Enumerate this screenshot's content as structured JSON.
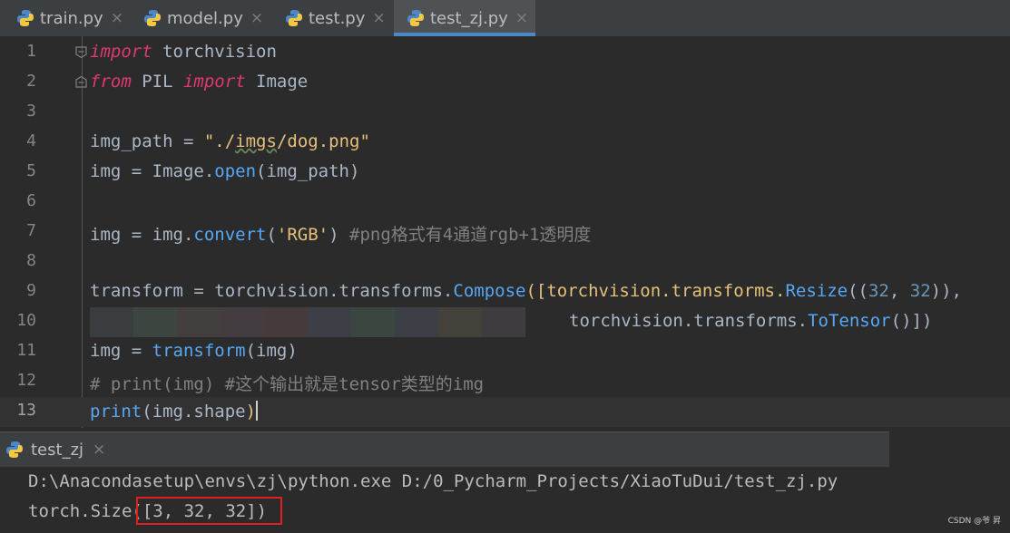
{
  "tabs": [
    {
      "label": "train.py",
      "active": false
    },
    {
      "label": "model.py",
      "active": false
    },
    {
      "label": "test.py",
      "active": false
    },
    {
      "label": "test_zj.py",
      "active": true
    }
  ],
  "close_glyph": "×",
  "editor": {
    "current_line": 13,
    "lines": [
      {
        "n": "1"
      },
      {
        "n": "2"
      },
      {
        "n": "3"
      },
      {
        "n": "4"
      },
      {
        "n": "5"
      },
      {
        "n": "6"
      },
      {
        "n": "7"
      },
      {
        "n": "8"
      },
      {
        "n": "9"
      },
      {
        "n": "10"
      },
      {
        "n": "11"
      },
      {
        "n": "12"
      },
      {
        "n": "13"
      }
    ],
    "tokens": {
      "l1_import": "import",
      "l1_mod": " torchvision",
      "l2_from": "from",
      "l2_pil": " PIL ",
      "l2_import": "import",
      "l2_image": " Image",
      "l4_var": "img_path = ",
      "l4_q1": "\"./",
      "l4_imgs": "imgs",
      "l4_rest": "/dog.png\"",
      "l5_a": "img = Image.",
      "l5_fn": "open",
      "l5_b": "(img_path)",
      "l7_a": "img = img.",
      "l7_fn": "convert",
      "l7_b": "(",
      "l7_str": "'RGB'",
      "l7_c": ") ",
      "l7_cm": "#png格式有4通道rgb+1透明度",
      "l9_a": "transform = torchvision.transforms.",
      "l9_fn": "Compose",
      "l9_b": "([torchvision.transforms.",
      "l9_fn2": "Resize",
      "l9_c": "((",
      "l9_n1": "32",
      "l9_d": ", ",
      "l9_n2": "32",
      "l9_e": ")),",
      "l10_a": "torchvision.transforms.",
      "l10_fn": "ToTensor",
      "l10_b": "()])",
      "l11_a": "img = ",
      "l11_fn": "transform",
      "l11_b": "(img)",
      "l12_cm": "# print(img) #这个输出就是tensor类型的img",
      "l13_fn": "print",
      "l13_a": "(img.shape",
      "l13_b": ")"
    },
    "colors": {
      "keyword": "#e0386e",
      "string": "#e6c07b",
      "function": "#56a8f5",
      "number": "#6897bb",
      "comment": "#808080",
      "text": "#a9b7c6"
    }
  },
  "run": {
    "tab_label": "test_zj",
    "output": [
      "D:\\Anacondasetup\\envs\\zj\\python.exe D:/0_Pycharm_Projects/XiaoTuDui/test_zj.py",
      "torch.Size([3, 32, 32])"
    ],
    "output_prefix": "torch.Size",
    "output_highlight": "([3, 32, 32])",
    "highlight_color": "#e02020"
  },
  "watermark": "CSDN @爷 昇"
}
